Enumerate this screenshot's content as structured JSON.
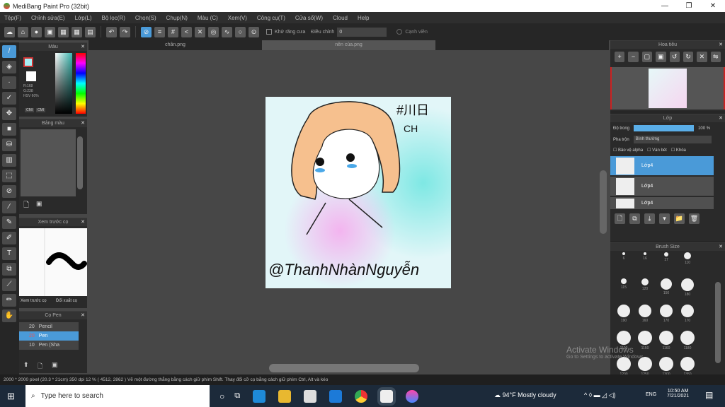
{
  "window": {
    "title": "MediBang Paint Pro (32bit)",
    "minimize": "—",
    "maximize": "❐",
    "close": "✕"
  },
  "menu": [
    "Tệp(F)",
    "Chỉnh sửa(E)",
    "Lớp(L)",
    "Bộ lọc(R)",
    "Chọn(S)",
    "Chụp(N)",
    "Màu (C)",
    "Xem(V)",
    "Công cụ(T)",
    "Cửa sổ(W)",
    "Cloud",
    "Help"
  ],
  "toolbar": {
    "autocorrect": "Khử răng cưa",
    "correction_label": "Điều chỉnh",
    "correction_value": "0",
    "edge": "Cạnh viền"
  },
  "tabs": [
    "chân.png",
    "nền của.png"
  ],
  "panels": {
    "color": "Màu",
    "palette": "Bảng màu",
    "brush_preview": "Xem trước cọ",
    "brush_preview_tab2": "Xem trước cọ",
    "brush_preview_tab3": "Đối xuất cọ",
    "brush_list": "Cọ Pen",
    "navigator": "Hoa tiêu",
    "layer": "Lớp",
    "brush_size": "Brush Size"
  },
  "color": {
    "hex": "#A8EEF4",
    "r": "R:168",
    "g": "G:238",
    "line3": "HSV 60%",
    "btn1": "CMI",
    "btn2": "CMI"
  },
  "brushes": [
    {
      "size": "20",
      "name": "Pencil"
    },
    {
      "size": "20",
      "name": "Pen",
      "selected": true
    },
    {
      "size": "10",
      "name": "Pen (Sha"
    }
  ],
  "layer": {
    "opacity_label": "Độ trong",
    "opacity_value": "100 %",
    "opacity": 1.0,
    "blend_label": "Pha trộn",
    "blend_value": "Bình thường",
    "opt1": "Bảo vệ alpha",
    "opt2": "Ván bét",
    "opt3": "Khóa",
    "layers": [
      "Lớp4",
      "Lớp4",
      "Lớp4"
    ]
  },
  "brush_sizes": [
    "6",
    "16",
    "17",
    "110",
    "115",
    "120",
    "150",
    "180",
    "190",
    "160",
    "170",
    "170",
    "1100",
    "1150",
    "1160",
    "1180",
    "1200",
    "1250",
    "1300",
    "1350"
  ],
  "artwork": {
    "text1": "#川日",
    "text2": "CH",
    "signature": "@ThanhNhànNguyễn"
  },
  "status": "2000 * 2000 pixel  (20.3 * 21cm)  350 dpi  12 %  ( 4512, 2862 )  Vẽ một đường thẳng bằng cách giữ phím Shift. Thay đổi cỡ cọ bằng cách giữ phím Ctrl, Alt và kéo",
  "watermark": {
    "line1": "Activate Windows",
    "line2": "Go to Settings to activate Windows."
  },
  "taskbar": {
    "search_placeholder": "Type here to search",
    "weather": "94°F  Mostly cloudy",
    "lang": "ENG",
    "time": "10:50 AM",
    "date": "7/21/2021"
  }
}
